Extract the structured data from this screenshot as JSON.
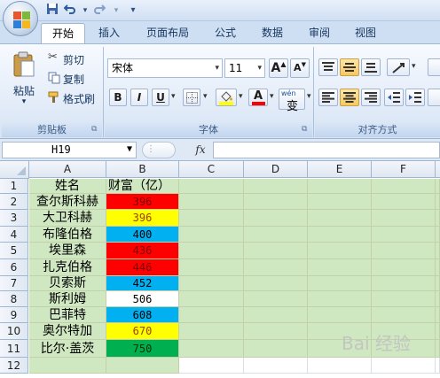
{
  "qat": {
    "save_icon": "save-icon",
    "undo_icon": "undo-icon",
    "redo_icon": "redo-icon",
    "customize": "▾"
  },
  "tabs": [
    {
      "label": "开始",
      "active": true
    },
    {
      "label": "插入"
    },
    {
      "label": "页面布局"
    },
    {
      "label": "公式"
    },
    {
      "label": "数据"
    },
    {
      "label": "审阅"
    },
    {
      "label": "视图"
    }
  ],
  "clipboard": {
    "paste": "粘贴",
    "cut": "剪切",
    "copy": "复制",
    "format_painter": "格式刷",
    "group": "剪贴板"
  },
  "font": {
    "name": "宋体",
    "size": "11",
    "grow": "A",
    "shrink": "A",
    "bold": "B",
    "italic": "I",
    "underline": "U",
    "font_color_glyph": "A",
    "phonetic": "wén",
    "phonetic_glyph": "变",
    "group": "字体"
  },
  "alignment": {
    "group": "对齐方式"
  },
  "name_box": "H19",
  "fx": "fx",
  "columns": [
    "A",
    "B",
    "C",
    "D",
    "E",
    "F"
  ],
  "rows": [
    "1",
    "2",
    "3",
    "4",
    "5",
    "6",
    "7",
    "8",
    "9",
    "10",
    "11",
    "12"
  ],
  "table": {
    "header": [
      "姓名",
      "财富（亿）"
    ],
    "records": [
      {
        "name": "查尔斯科赫",
        "value": "396",
        "fill": "#ff0000",
        "text_color": "#7a0000"
      },
      {
        "name": "大卫科赫",
        "value": "396",
        "fill": "#ffff00",
        "text_color": "#a04000"
      },
      {
        "name": "布隆伯格",
        "value": "400",
        "fill": "#00b0f0",
        "text_color": "#000000"
      },
      {
        "name": "埃里森",
        "value": "436",
        "fill": "#ff0000",
        "text_color": "#7a0000"
      },
      {
        "name": "扎克伯格",
        "value": "446",
        "fill": "#ff0000",
        "text_color": "#7a0000"
      },
      {
        "name": "贝索斯",
        "value": "452",
        "fill": "#00b0f0",
        "text_color": "#000000"
      },
      {
        "name": "斯利姆",
        "value": "506",
        "fill": "#ffffff",
        "text_color": "#000000"
      },
      {
        "name": "巴菲特",
        "value": "608",
        "fill": "#00b0f0",
        "text_color": "#000000"
      },
      {
        "name": "奥尔特加",
        "value": "670",
        "fill": "#ffff00",
        "text_color": "#a04000"
      },
      {
        "name": "比尔·盖茨",
        "value": "750",
        "fill": "#00b050",
        "text_color": "#003000"
      }
    ]
  },
  "watermark": "Bai 经验"
}
